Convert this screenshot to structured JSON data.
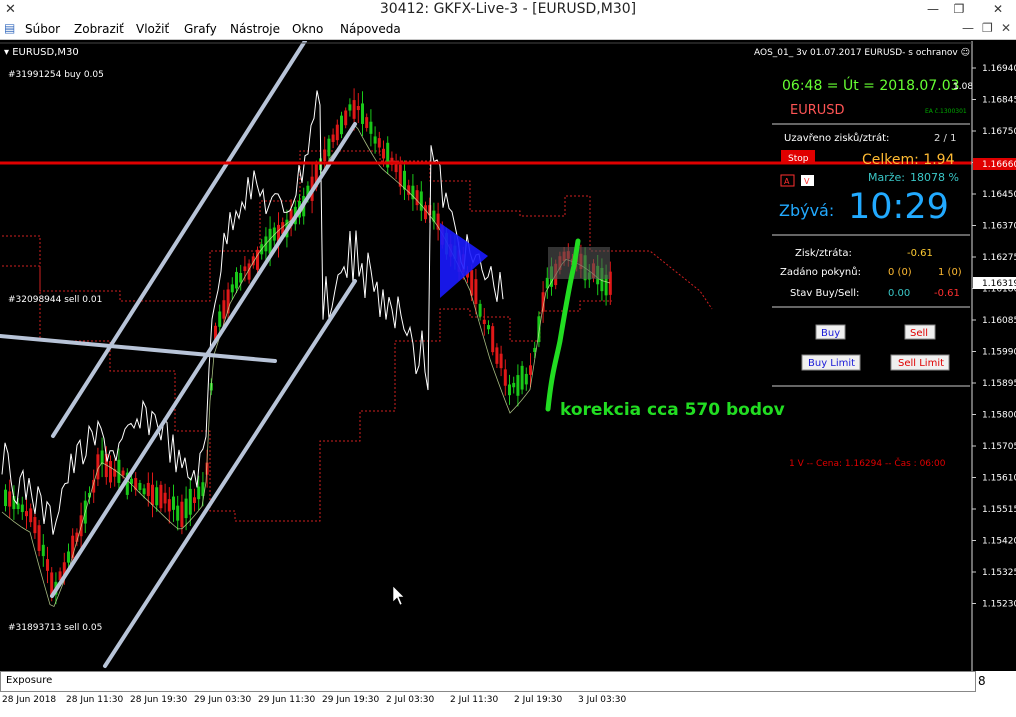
{
  "window": {
    "title": "30412: GKFX-Live-3 - [EURUSD,M30]",
    "minimize": "—",
    "restore": "❐",
    "close": "✕"
  },
  "menu": [
    "Súbor",
    "Zobraziť",
    "Vložiť",
    "Grafy",
    "Nástroje",
    "Okno",
    "Nápoveda"
  ],
  "chart": {
    "symbol_label": "EURUSD,M30",
    "ea_header": "AOS_01_ 3v 01.07.2017 EURUSD- s ochranov ☺",
    "order1": "#31991254 buy 0.05",
    "order2": "#32098944 sell 0.01",
    "order3": "#31893713 sell 0.05",
    "annotation": "korekcia cca 570 bodov",
    "price_labels": [
      "1.16940",
      "1.16845",
      "1.16750",
      "1.16660",
      "1.16555",
      "1.16450",
      "1.16370",
      "1.16319",
      "1.16275",
      "1.16180",
      "1.16085",
      "1.15990",
      "1.15895",
      "1.15800",
      "1.15705",
      "1.15610",
      "1.15515",
      "1.15420",
      "1.15325",
      "1.15230"
    ],
    "current_price": "1.16319",
    "stop_price": "1.16660",
    "time_labels": [
      "28 Jun 2018",
      "28 Jun 11:30",
      "28 Jun 19:30",
      "29 Jun 03:30",
      "29 Jun 11:30",
      "29 Jun 19:30",
      "2 Jul 03:30",
      "2 Jul 11:30",
      "2 Jul 19:30",
      "3 Jul 03:30"
    ]
  },
  "panel": {
    "time_line": "06:48 = Út = 2018.07.03",
    "time_suffix": "1.08",
    "symbol": "EURUSD",
    "ea_code": "EA č.1300301",
    "closed_label": "Uzavřeno zisků/ztrát:",
    "closed_value": "2 / 1",
    "stop_button": "Stop",
    "total": "Celkem: 1.94",
    "box_a": "A",
    "box_v": "V",
    "margin_label": "Marže:",
    "margin_value": "18078 %",
    "remaining_label": "Zbývá:",
    "remaining_value": "10:29",
    "pl_label": "Zisk/ztráta:",
    "pl_value": "-0.61",
    "orders_label": "Zadáno pokynů:",
    "orders_buy": "0 (0)",
    "orders_sell": "1 (0)",
    "state_label": "Stav Buy/Sell:",
    "state_buy": "0.00",
    "state_sell": "-0.61",
    "buy_button": "Buy",
    "sell_button": "Sell",
    "buy_limit_button": "Buy Limit",
    "sell_limit_button": "Sell Limit",
    "last_trade": "1 V -- Cena: 1.16294 -- Čas : 06:00"
  },
  "exposure": {
    "label": "Exposure"
  },
  "scroll_value": "8",
  "colors": {
    "bull": "#19c919",
    "bear": "#e01818",
    "stop_line": "#e00000",
    "annotation": "#22dd22",
    "channel": "#b8c4d8",
    "panel_red": "#ff3030",
    "time_green": "#66ff33",
    "remaining": "#22aaff",
    "total": "#ffbb33"
  }
}
